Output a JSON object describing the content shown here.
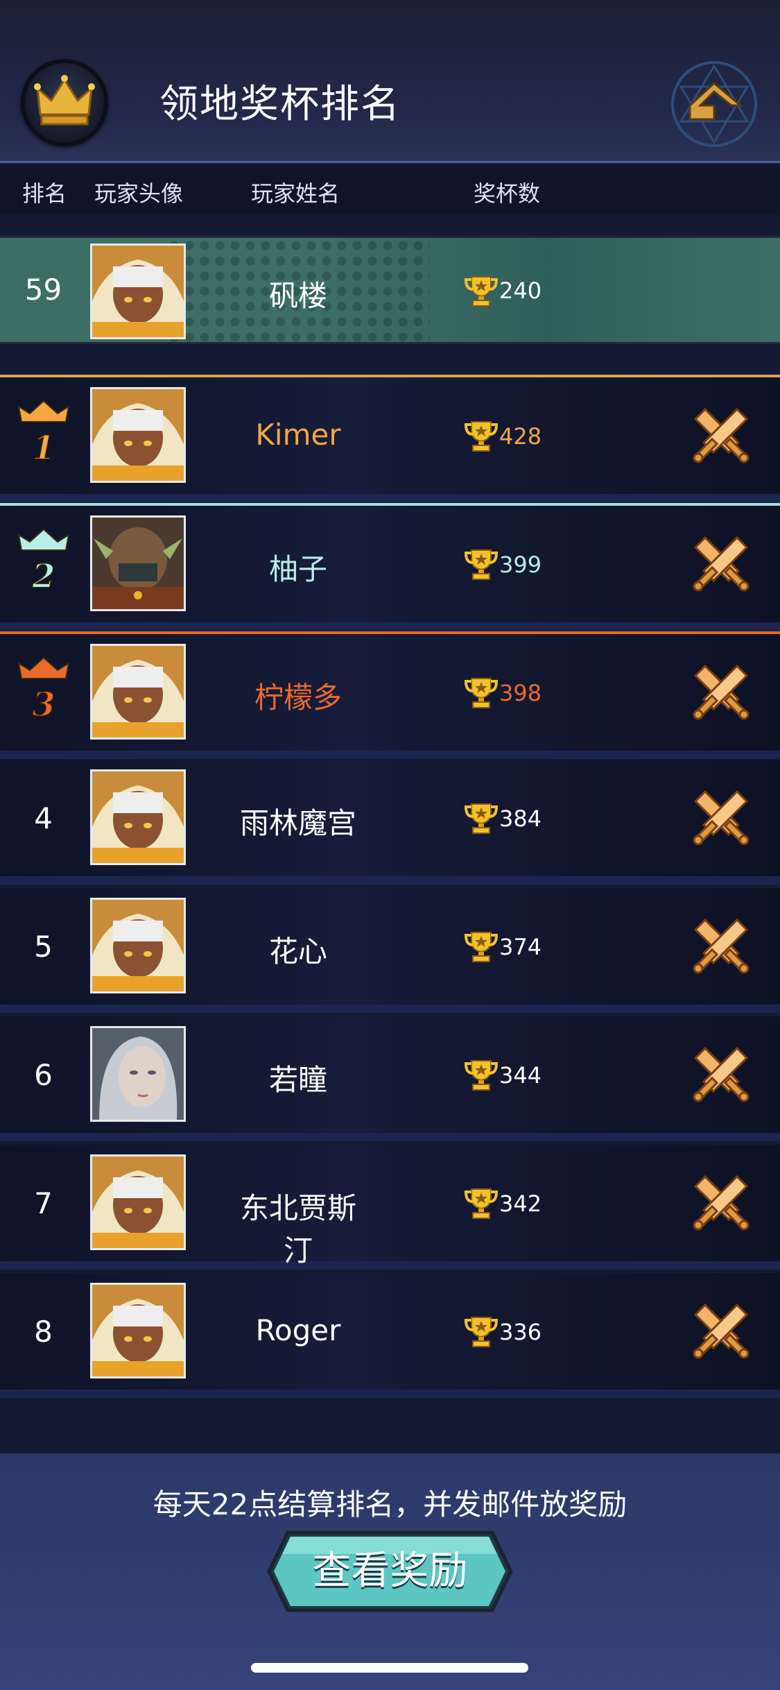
{
  "header": {
    "title": "领地奖杯排名",
    "crown_icon": "crown-icon",
    "back_icon": "return-arrow-icon"
  },
  "columns": {
    "rank": "排名",
    "avatar": "玩家头像",
    "name": "玩家姓名",
    "trophies": "奖杯数"
  },
  "self_row": {
    "rank": "59",
    "name": "矾楼",
    "trophies": "240",
    "avatar": "female-cat-avatar"
  },
  "rows": [
    {
      "rank": "1",
      "name": "Kimer",
      "trophies": "428",
      "color": "#f4a640",
      "avatar": "female-cat-avatar"
    },
    {
      "rank": "2",
      "name": "柚子",
      "trophies": "399",
      "color": "#b8eee8",
      "avatar": "elf-warrior-avatar"
    },
    {
      "rank": "3",
      "name": "柠檬多",
      "trophies": "398",
      "color": "#ea6a2c",
      "avatar": "female-cat-avatar"
    },
    {
      "rank": "4",
      "name": "雨林魔宫",
      "trophies": "384",
      "color": "#ffffff",
      "avatar": "female-cat-avatar"
    },
    {
      "rank": "5",
      "name": "花心",
      "trophies": "374",
      "color": "#ffffff",
      "avatar": "female-cat-avatar"
    },
    {
      "rank": "6",
      "name": "若瞳",
      "trophies": "344",
      "color": "#ffffff",
      "avatar": "portrait-photo-avatar"
    },
    {
      "rank": "7",
      "name": "东北贾斯汀",
      "trophies": "342",
      "color": "#ffffff",
      "avatar": "female-cat-avatar"
    },
    {
      "rank": "8",
      "name": "Roger",
      "trophies": "336",
      "color": "#ffffff",
      "avatar": "female-cat-avatar"
    }
  ],
  "footer": {
    "note": "每天22点结算排名，并发邮件放奖励",
    "button": "查看奖励"
  }
}
